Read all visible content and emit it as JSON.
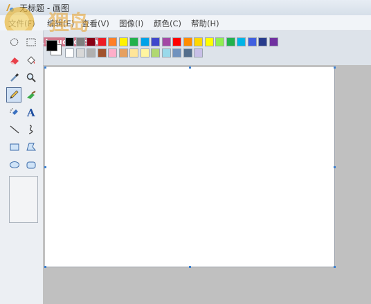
{
  "window": {
    "title": "无标题 - 画图",
    "app_icon": "paint-icon"
  },
  "watermark": {
    "logo_text": "狸岛",
    "url": "bbs.houdao.com"
  },
  "menubar": {
    "items": [
      {
        "label": "文件(F)"
      },
      {
        "label": "编辑(E)"
      },
      {
        "label": "查看(V)"
      },
      {
        "label": "图像(I)"
      },
      {
        "label": "颜色(C)"
      },
      {
        "label": "帮助(H)"
      }
    ]
  },
  "toolbox": {
    "tools": [
      {
        "name": "free-form-select-icon"
      },
      {
        "name": "select-icon"
      },
      {
        "name": "eraser-icon"
      },
      {
        "name": "fill-icon"
      },
      {
        "name": "color-picker-icon"
      },
      {
        "name": "magnifier-icon"
      },
      {
        "name": "pencil-icon",
        "active": true
      },
      {
        "name": "brush-icon"
      },
      {
        "name": "airbrush-icon"
      },
      {
        "name": "text-icon"
      },
      {
        "name": "line-icon"
      },
      {
        "name": "curve-icon"
      },
      {
        "name": "rectangle-icon"
      },
      {
        "name": "polygon-icon"
      },
      {
        "name": "ellipse-icon"
      },
      {
        "name": "rounded-rectangle-icon"
      }
    ]
  },
  "palette": {
    "primary": "#000000",
    "secondary": "#ffffff",
    "row1": [
      "#000000",
      "#7f7f7f",
      "#880015",
      "#ed1c24",
      "#ff7f27",
      "#fff200",
      "#22b14c",
      "#00a2e8",
      "#3f48cc",
      "#a349a4",
      "#ff0000",
      "#ff8c00",
      "#ffd700",
      "#ffff00",
      "#90ee50",
      "#22b14c",
      "#00b4e6",
      "#4060e0",
      "#283c8c",
      "#7030a0"
    ],
    "row2": [
      "#ffffff",
      "#d8d8d8",
      "#b0b0b0",
      "#a0522d",
      "#ffaec9",
      "#e6a060",
      "#ffe599",
      "#fff5a0",
      "#b0d870",
      "#99d9ea",
      "#7092be",
      "#546e8c",
      "#c8bfe7"
    ]
  },
  "colors": {
    "canvas_bg": "#ffffff",
    "workspace_bg": "#c0c0c0",
    "selection_handle": "#3a7fd0"
  }
}
